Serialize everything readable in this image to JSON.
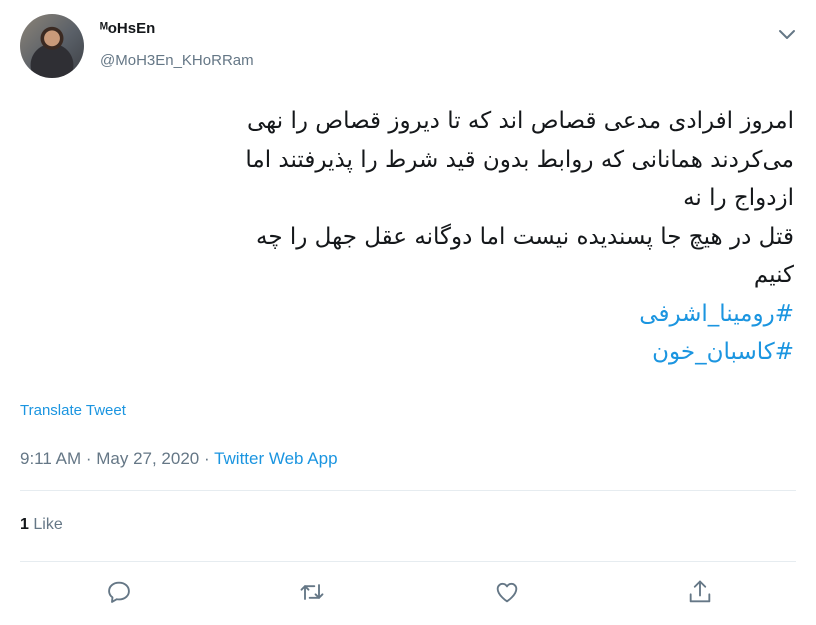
{
  "author": {
    "display_name": "ᴹoHsEn",
    "handle": "@MoH3En_KHoRRam"
  },
  "tweet": {
    "lines": [
      "امروز افرادی مدعی قصاص اند که تا دیروز  قصاص را نهی",
      "می‌کردند همانانی که روابط بدون قید شرط را پذیرفتند اما",
      "ازدواج را نه",
      "قتل در هیچ جا پسندیده نیست  اما دوگانه عقل جهل را چه",
      "کنیم"
    ],
    "hashtags": [
      "#رومینا_اشرفی",
      "#کاسبان_خون"
    ]
  },
  "translate_label": "Translate Tweet",
  "meta": {
    "time": "9:11 AM",
    "sep1": " · ",
    "date": "May 27, 2020",
    "sep2": " · ",
    "source": "Twitter Web App"
  },
  "stats": {
    "likes_count": "1",
    "likes_label": "Like"
  },
  "actions": [
    "reply-icon",
    "retweet-icon",
    "like-icon",
    "share-icon"
  ],
  "colors": {
    "link": "#1b95e0",
    "muted": "#657786",
    "text": "#14171a",
    "name_icon": "#f5a623"
  }
}
